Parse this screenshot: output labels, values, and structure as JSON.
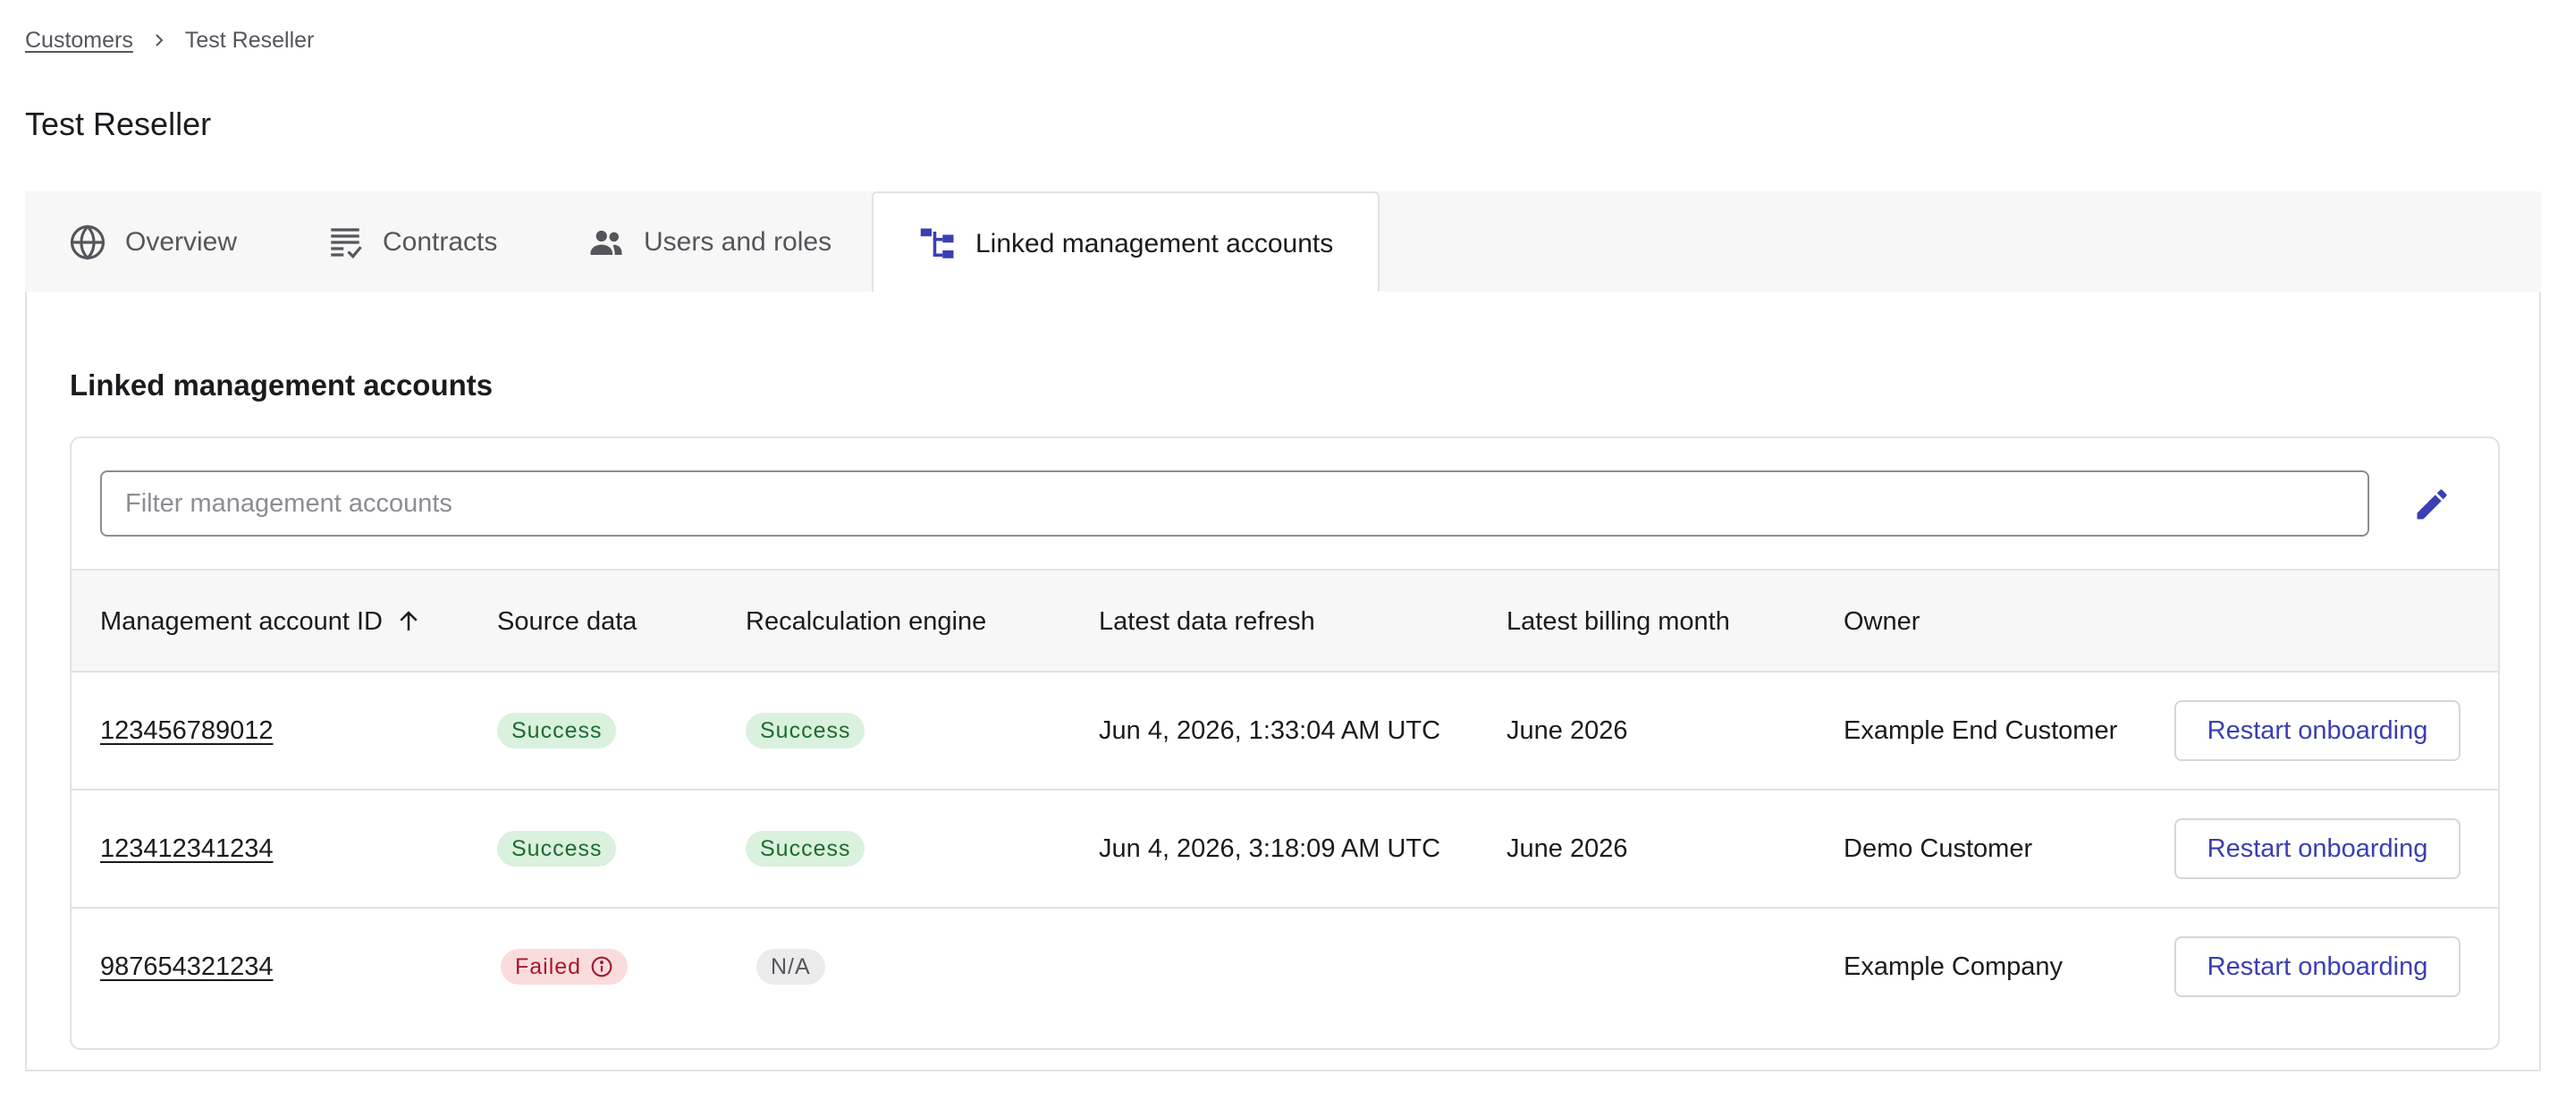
{
  "breadcrumb": {
    "parent": "Customers",
    "current": "Test Reseller"
  },
  "page_title": "Test Reseller",
  "tabs": [
    {
      "label": "Overview",
      "icon": "globe-icon"
    },
    {
      "label": "Contracts",
      "icon": "list-check-icon"
    },
    {
      "label": "Users and roles",
      "icon": "people-icon"
    },
    {
      "label": "Linked management accounts",
      "icon": "hierarchy-icon",
      "active": true
    }
  ],
  "section_title": "Linked management accounts",
  "filter": {
    "placeholder": "Filter management accounts",
    "value": ""
  },
  "table": {
    "columns": [
      "Management account ID",
      "Source data",
      "Recalculation engine",
      "Latest data refresh",
      "Latest billing month",
      "Owner"
    ],
    "sort_column": "Management account ID",
    "sort_direction": "ascending",
    "rows": [
      {
        "id": "123456789012",
        "source": "Success",
        "recalc": "Success",
        "refresh": "Jun 4, 2026, 1:33:04 AM UTC",
        "billing": "June 2026",
        "owner": "Example End Customer",
        "action": "Restart onboarding"
      },
      {
        "id": "123412341234",
        "source": "Success",
        "recalc": "Success",
        "refresh": "Jun 4, 2026, 3:18:09 AM UTC",
        "billing": "June 2026",
        "owner": "Demo Customer",
        "action": "Restart onboarding"
      },
      {
        "id": "987654321234",
        "source": "Failed",
        "recalc": "N/A",
        "refresh": "",
        "billing": "",
        "owner": "Example Company",
        "action": "Restart onboarding"
      }
    ]
  },
  "colors": {
    "accent": "#3a3fb4",
    "success_bg": "#d9f1dd",
    "success_text": "#1d6b32",
    "failed_bg": "#fbdcdc",
    "failed_text": "#a3192d"
  }
}
